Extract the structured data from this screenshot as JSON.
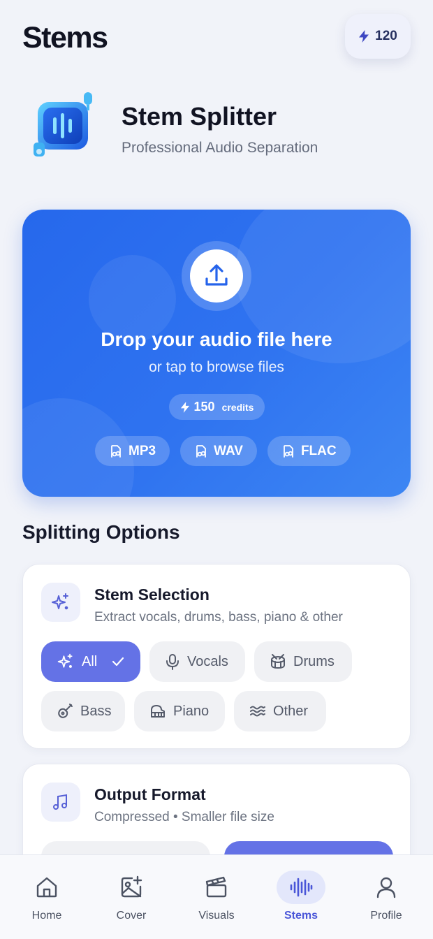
{
  "header": {
    "title": "Stems",
    "credits": "120"
  },
  "hero": {
    "title": "Stem Splitter",
    "subtitle": "Professional Audio Separation"
  },
  "upload": {
    "title": "Drop your audio file here",
    "subtitle": "or tap to browse files",
    "credits_value": "150",
    "credits_label": "credits",
    "formats": [
      "MP3",
      "WAV",
      "FLAC"
    ]
  },
  "section_title": "Splitting Options",
  "stem_selection": {
    "title": "Stem Selection",
    "description": "Extract vocals, drums, bass, piano & other",
    "options": [
      {
        "label": "All",
        "icon": "sparkles-icon",
        "selected": true
      },
      {
        "label": "Vocals",
        "icon": "microphone-icon",
        "selected": false
      },
      {
        "label": "Drums",
        "icon": "drum-icon",
        "selected": false
      },
      {
        "label": "Bass",
        "icon": "guitar-icon",
        "selected": false
      },
      {
        "label": "Piano",
        "icon": "piano-icon",
        "selected": false
      },
      {
        "label": "Other",
        "icon": "waves-icon",
        "selected": false
      }
    ]
  },
  "output_format": {
    "title": "Output Format",
    "description": "Compressed • Smaller file size"
  },
  "nav": {
    "items": [
      {
        "label": "Home",
        "icon": "home-icon"
      },
      {
        "label": "Cover",
        "icon": "image-plus-icon"
      },
      {
        "label": "Visuals",
        "icon": "clapperboard-icon"
      },
      {
        "label": "Stems",
        "icon": "audio-waveform-icon",
        "active": true
      },
      {
        "label": "Profile",
        "icon": "user-icon"
      }
    ]
  },
  "colors": {
    "accent": "#6472e6",
    "upload_blue": "#2f73f0",
    "nav_active": "#4a56d8"
  }
}
